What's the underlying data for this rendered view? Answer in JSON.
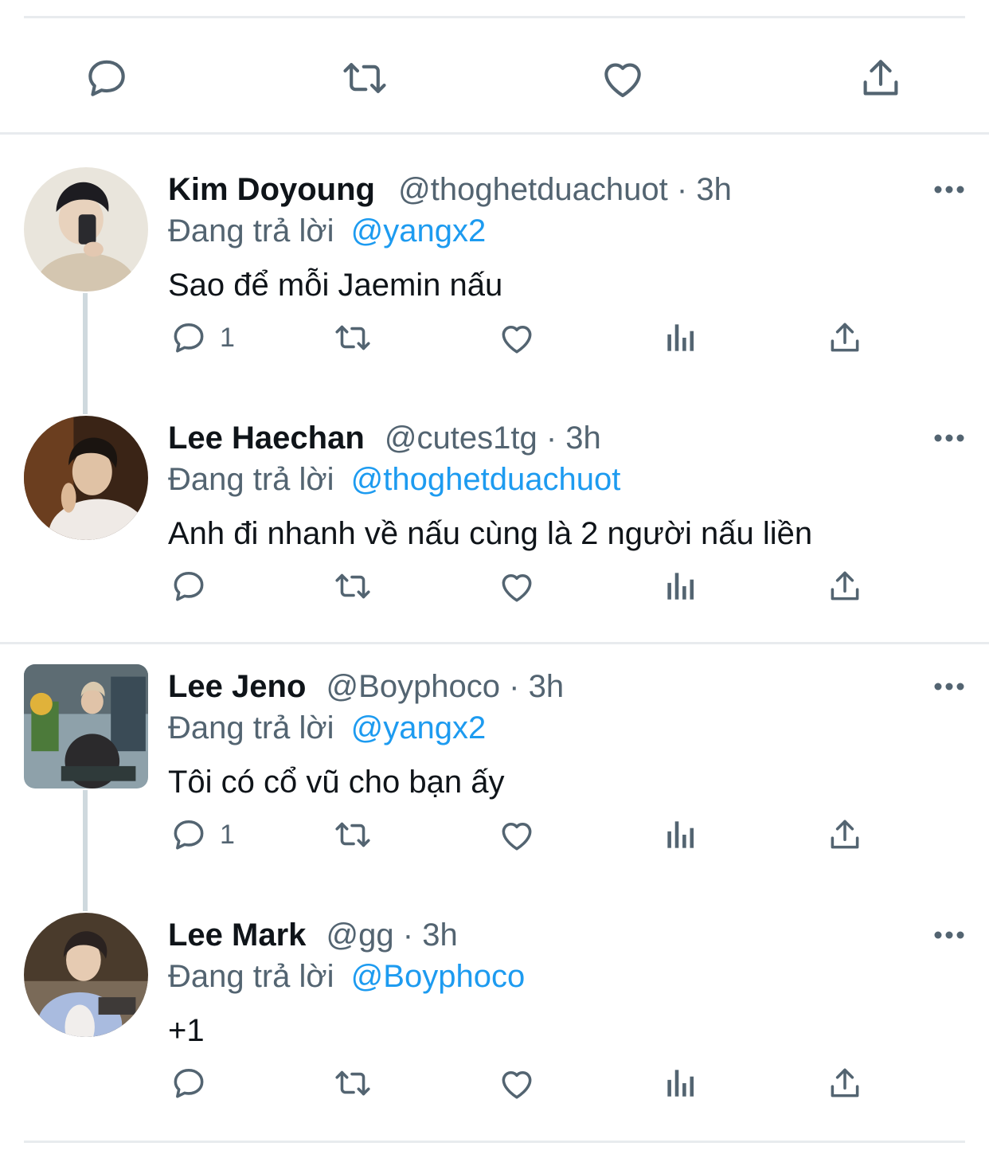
{
  "colors": {
    "accent": "#1d9bf0",
    "secondary_text": "#536471",
    "divider": "#e8ebee",
    "thread_line": "#cfd9de"
  },
  "top_actions": {
    "icons": [
      "reply-icon",
      "retweet-icon",
      "like-icon",
      "share-icon"
    ]
  },
  "replies": [
    {
      "name": "Kim Doyoung",
      "handle": "@thoghetduachuot",
      "dot": "·",
      "time": "3h",
      "replying_prefix": "Đang trả lời",
      "replying_to": "@yangx2",
      "text": "Sao để mỗi Jaemin nấu",
      "reply_count": "1",
      "avatar": "round"
    },
    {
      "name": "Lee Haechan",
      "handle": "@cutes1tg",
      "dot": "·",
      "time": "3h",
      "replying_prefix": "Đang trả lời",
      "replying_to": "@thoghetduachuot",
      "text": "Anh đi nhanh về nấu cùng là 2 người nấu liền",
      "reply_count": "",
      "avatar": "round"
    },
    {
      "name": "Lee Jeno",
      "handle": "@Boyphoco",
      "dot": "·",
      "time": "3h",
      "replying_prefix": "Đang trả lời",
      "replying_to": "@yangx2",
      "text": "Tôi có cổ vũ cho bạn ấy",
      "reply_count": "1",
      "avatar": "square"
    },
    {
      "name": "Lee Mark",
      "handle": "@gg",
      "dot": "·",
      "time": "3h",
      "replying_prefix": "Đang trả lời",
      "replying_to": "@Boyphoco",
      "text": "+1",
      "reply_count": "",
      "avatar": "round"
    }
  ]
}
